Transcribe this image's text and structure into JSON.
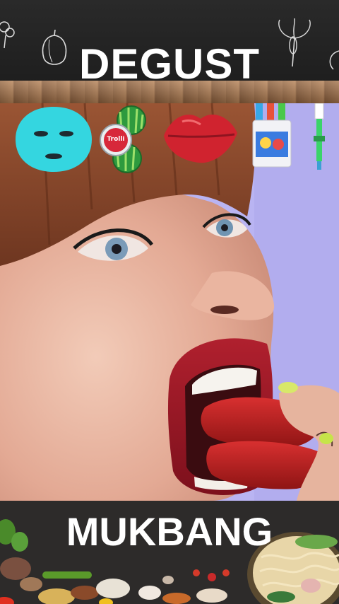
{
  "header": {
    "title": "DEGUST"
  },
  "footer": {
    "title": "MUKBANG"
  },
  "stickers": {
    "candy_brand": "Trolli"
  },
  "colors": {
    "mask": "#34d6e0",
    "lips": "#d0232f",
    "background": "#b8b4f0",
    "hair": "#8a4a2a"
  }
}
